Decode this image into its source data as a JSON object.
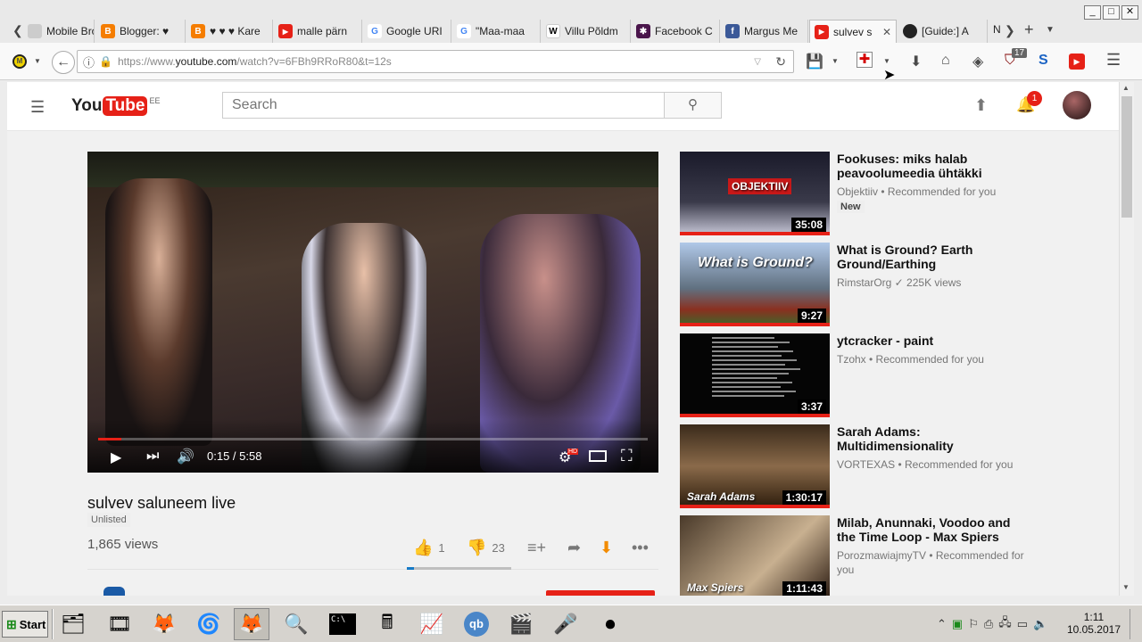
{
  "window": {
    "min": "_",
    "max": "□",
    "close": "✕"
  },
  "tabs": [
    {
      "label": "Mobile Bro",
      "fav": "mobile-broadband-icon",
      "color": "#cccccc"
    },
    {
      "label": "Blogger: ♥",
      "fav": "blogger-icon",
      "color": "#f57d00"
    },
    {
      "label": "♥ ♥ ♥ Kare",
      "fav": "blogger-icon",
      "color": "#f57d00"
    },
    {
      "label": "malle pärn",
      "fav": "youtube-icon",
      "color": "#e62117"
    },
    {
      "label": "Google URI",
      "fav": "google-icon",
      "color": "#4285f4"
    },
    {
      "label": "\"Maa-maa",
      "fav": "google-icon",
      "color": "#4285f4"
    },
    {
      "label": "Villu Põldm",
      "fav": "wikipedia-icon",
      "color": "#ffffff"
    },
    {
      "label": "Facebook C",
      "fav": "slack-icon",
      "color": "#4a154b"
    },
    {
      "label": "Margus Me",
      "fav": "facebook-icon",
      "color": "#3b5998"
    },
    {
      "label": "sulvev s",
      "fav": "youtube-icon",
      "color": "#e62117",
      "active": true
    },
    {
      "label": "[Guide:] A",
      "fav": "github-icon",
      "color": "#222222"
    }
  ],
  "tab_overflow": "N",
  "new_tab": "+",
  "url": {
    "prefix": "https://www.",
    "domain": "youtube.com",
    "rest": "/watch?v=6FBh9RRoR80&t=12s"
  },
  "toolbar_badges": {
    "ublock": "17"
  },
  "yt": {
    "logo_you": "You",
    "logo_tube": "Tube",
    "region": "EE",
    "search_placeholder": "Search",
    "notif_count": "1"
  },
  "player": {
    "time": "0:15 / 5:58",
    "progress": 0.042,
    "hd": "HD"
  },
  "video": {
    "title": "sulvev saluneem live",
    "status": "Unlisted",
    "views": "1,865 views",
    "likes": "1",
    "dislikes": "23"
  },
  "recommendations": [
    {
      "title": "Fookuses: miks halab peavoolumeedia ühtäkki",
      "channel": "Objektiiv • Recommended for you",
      "extra": "New",
      "duration": "35:08",
      "thumb_text": "OBJEKTIIV"
    },
    {
      "title": "What is Ground? Earth Ground/Earthing",
      "channel": "RimstarOrg ✓ 225K views",
      "extra": "",
      "duration": "9:27",
      "thumb_text": "What is Ground?"
    },
    {
      "title": "ytcracker - paint",
      "channel": "Tzohx • Recommended for you",
      "extra": "",
      "duration": "3:37",
      "thumb_text": ""
    },
    {
      "title": "Sarah Adams: Multidimensionality",
      "channel": "VORTEXAS • Recommended for you",
      "extra": "",
      "duration": "1:30:17",
      "thumb_text": "Sarah Adams"
    },
    {
      "title": "Milab, Anunnaki, Voodoo and the Time Loop - Max Spiers",
      "channel": "PorozmawiajmyTV • Recommended for you",
      "extra": "",
      "duration": "1:11:43",
      "thumb_text": "Max Spiers"
    }
  ],
  "taskbar": {
    "start": "Start",
    "time": "1:11",
    "date": "10.05.2017"
  }
}
